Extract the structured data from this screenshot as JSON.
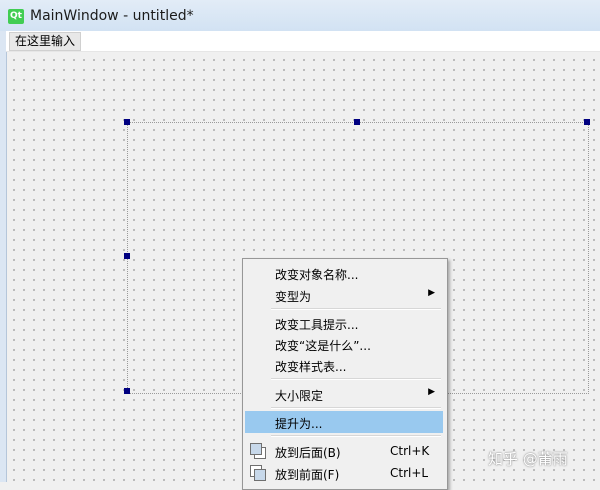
{
  "window": {
    "title": "MainWindow - untitled*",
    "logo_text": "Qt"
  },
  "menubar": {
    "placeholder": "在这里输入"
  },
  "context_menu": {
    "items": [
      {
        "label": "改变对象名称..."
      },
      {
        "label": "变型为",
        "arrow": "▶"
      },
      {
        "label": "改变工具提示..."
      },
      {
        "label": "改变“这是什么”..."
      },
      {
        "label": "改变样式表..."
      },
      {
        "label": "大小限定",
        "arrow": "▶"
      },
      {
        "label": "提升为...",
        "highlighted": true
      },
      {
        "label": "放到后面(B)",
        "shortcut": "Ctrl+K"
      },
      {
        "label": "放到前面(F)",
        "shortcut": "Ctrl+L"
      }
    ]
  },
  "watermark": "知乎 @莆雨",
  "colors": {
    "highlight": "#99c9ef",
    "handle": "#000080",
    "qt_green": "#41cd52"
  }
}
